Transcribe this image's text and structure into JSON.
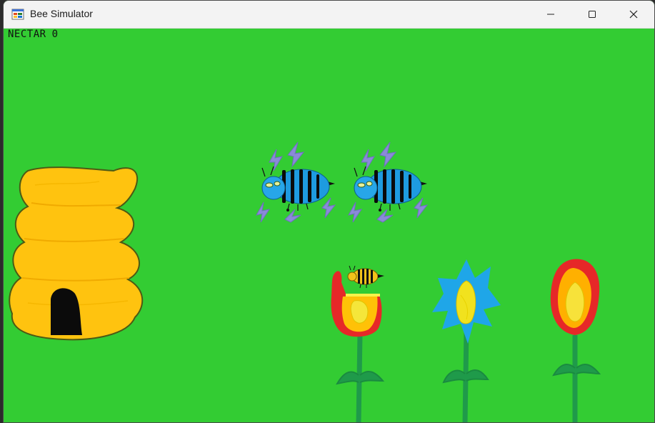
{
  "window": {
    "title": "Bee Simulator",
    "icon": "app-window-icon",
    "controls": [
      "minimize",
      "maximize",
      "close"
    ]
  },
  "hud": {
    "label": "NECTAR",
    "value": "0"
  },
  "scene": {
    "background_color": "#33cc33",
    "hive": {
      "name": "beehive",
      "color": "#ffc30f"
    },
    "enemies": [
      {
        "name": "blue-electric-bee",
        "color": "#1e9be0"
      },
      {
        "name": "blue-electric-bee",
        "color": "#1e9be0"
      }
    ],
    "player": {
      "name": "player-bee",
      "color": "#f3c21a"
    },
    "flowers": [
      {
        "name": "red-flower",
        "petal_color": "#e62828",
        "inner_color": "#ffc107"
      },
      {
        "name": "blue-flower",
        "petal_color": "#1fa6e8",
        "inner_color": "#f1e21e"
      },
      {
        "name": "fire-flower",
        "petal_color": "#e62828",
        "inner_color": "#ffb000"
      }
    ]
  }
}
